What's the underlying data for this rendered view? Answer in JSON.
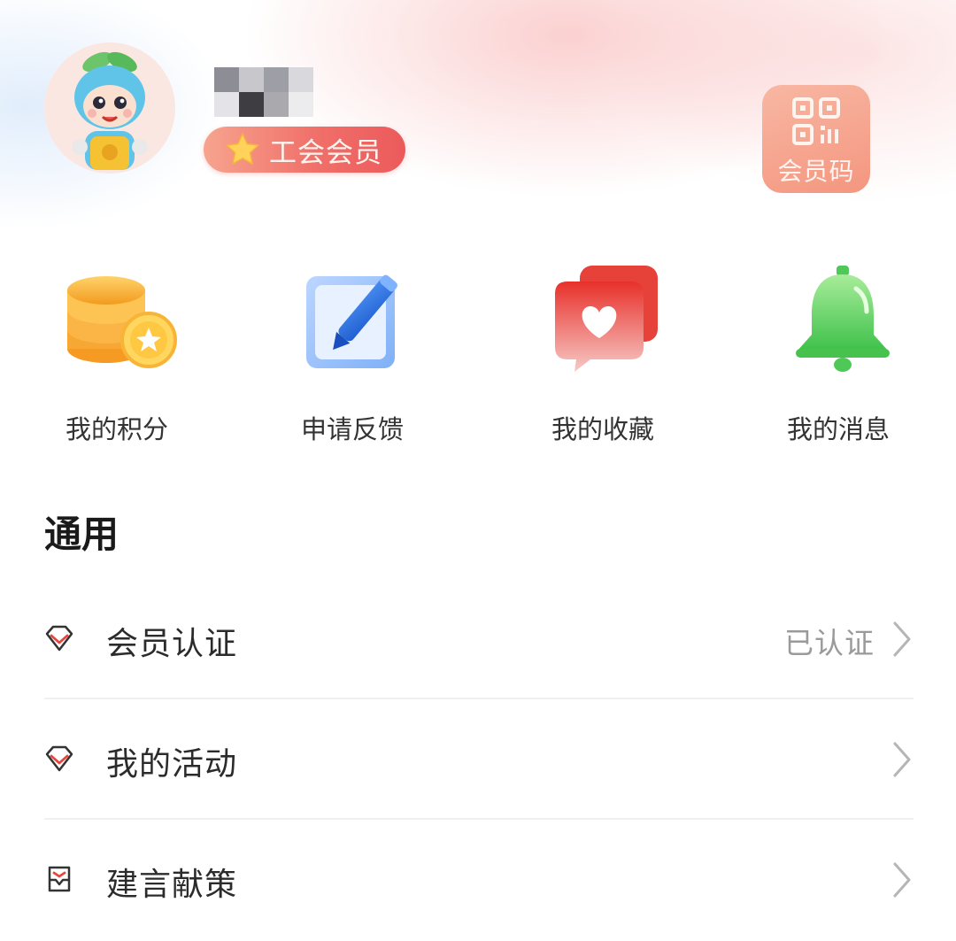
{
  "profile": {
    "badge_label": "工会会员",
    "qr_label": "会员码",
    "mosaic_colors": [
      "#8d8d96",
      "#c8c8cc",
      "#9e9ea6",
      "#d9d9dd",
      "#e4e4e8",
      "#3d3d42",
      "#a9a9ae",
      "#ececef"
    ]
  },
  "shortcuts": [
    {
      "label": "我的积分",
      "icon": "coins-icon"
    },
    {
      "label": "申请反馈",
      "icon": "edit-pencil-icon"
    },
    {
      "label": "我的收藏",
      "icon": "favorite-heart-icon"
    },
    {
      "label": "我的消息",
      "icon": "bell-icon"
    }
  ],
  "general": {
    "title": "通用",
    "items": [
      {
        "label": "会员认证",
        "value": "已认证",
        "icon": "diamond-icon"
      },
      {
        "label": "我的活动",
        "value": "",
        "icon": "diamond-icon"
      },
      {
        "label": "建言献策",
        "value": "",
        "icon": "suggestion-box-icon"
      }
    ]
  },
  "colors": {
    "accent": "#ec5a5b",
    "badge_gradient_start": "#f7a48f",
    "qr_bg": "#f4967f",
    "muted_text": "#9a9a9a"
  }
}
